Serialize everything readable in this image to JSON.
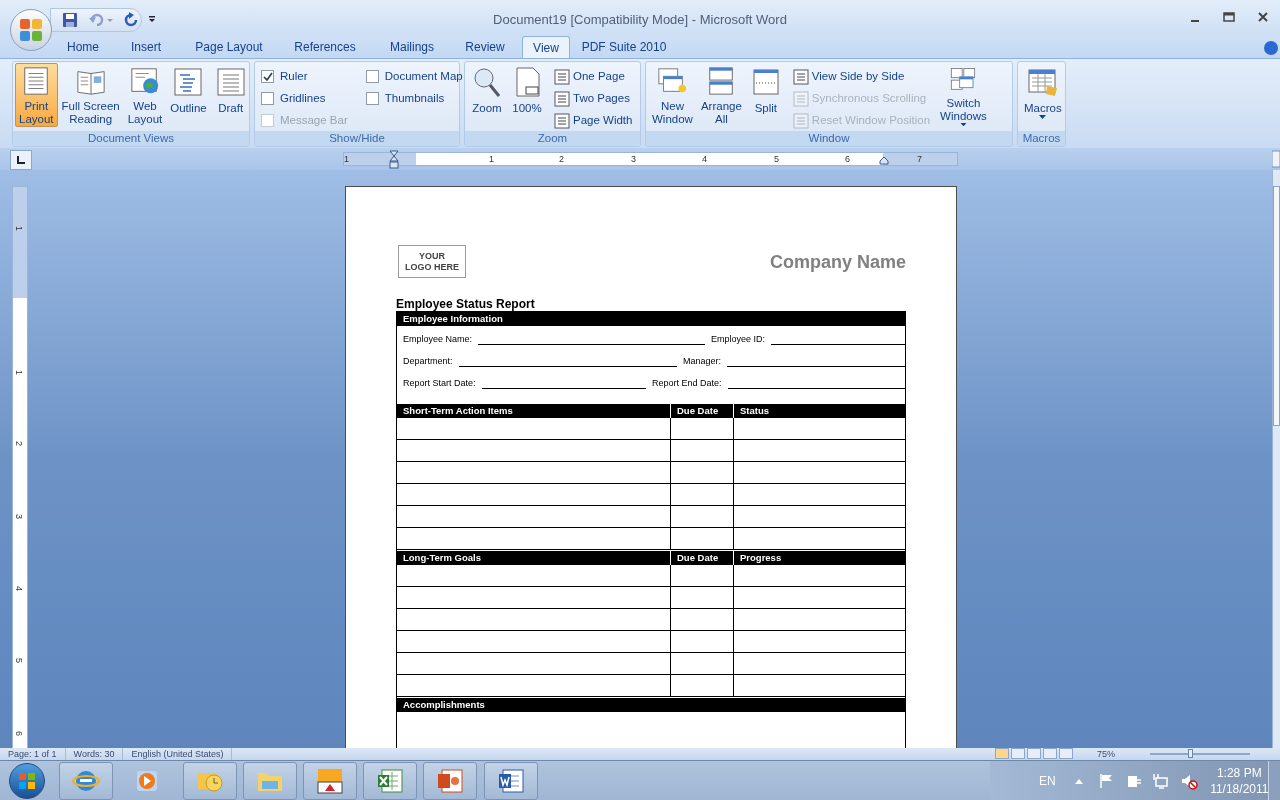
{
  "window": {
    "title": "Document19 [Compatibility Mode] - Microsoft Word"
  },
  "tabs": [
    {
      "label": "Home",
      "selected": false
    },
    {
      "label": "Insert",
      "selected": false
    },
    {
      "label": "Page Layout",
      "selected": false
    },
    {
      "label": "References",
      "selected": false
    },
    {
      "label": "Mailings",
      "selected": false
    },
    {
      "label": "Review",
      "selected": false
    },
    {
      "label": "View",
      "selected": true
    },
    {
      "label": "PDF Suite 2010",
      "selected": false
    }
  ],
  "ribbon": [
    {
      "label": "Document Views",
      "controls": [
        {
          "kind": "large",
          "label": "Print Layout",
          "selected": true
        },
        {
          "kind": "large",
          "label": "Full Screen Reading",
          "selected": false
        },
        {
          "kind": "large",
          "label": "Web Layout",
          "selected": false
        },
        {
          "kind": "large",
          "label": "Outline",
          "selected": false
        },
        {
          "kind": "large",
          "label": "Draft",
          "selected": false
        }
      ]
    },
    {
      "label": "Show/Hide",
      "controls": [
        {
          "kind": "checkbox",
          "label": "Ruler",
          "checked": true,
          "disabled": false
        },
        {
          "kind": "checkbox",
          "label": "Gridlines",
          "checked": false,
          "disabled": false
        },
        {
          "kind": "checkbox",
          "label": "Message Bar",
          "checked": false,
          "disabled": true
        },
        {
          "kind": "checkbox",
          "label": "Document Map",
          "checked": false,
          "disabled": false
        },
        {
          "kind": "checkbox",
          "label": "Thumbnails",
          "checked": false,
          "disabled": false
        }
      ]
    },
    {
      "label": "Zoom",
      "controls": [
        {
          "kind": "large",
          "label": "Zoom",
          "selected": false
        },
        {
          "kind": "large",
          "label": "100%",
          "selected": false
        },
        {
          "kind": "small",
          "label": "One Page",
          "disabled": false
        },
        {
          "kind": "small",
          "label": "Two Pages",
          "disabled": false
        },
        {
          "kind": "small",
          "label": "Page Width",
          "disabled": false
        }
      ]
    },
    {
      "label": "Window",
      "controls": [
        {
          "kind": "large",
          "label": "New Window",
          "selected": false
        },
        {
          "kind": "large",
          "label": "Arrange All",
          "selected": false
        },
        {
          "kind": "large",
          "label": "Split",
          "selected": false
        },
        {
          "kind": "small",
          "label": "View Side by Side",
          "disabled": false
        },
        {
          "kind": "small",
          "label": "Synchronous Scrolling",
          "disabled": true
        },
        {
          "kind": "small",
          "label": "Reset Window Position",
          "disabled": true
        },
        {
          "kind": "large",
          "label": "Switch Windows",
          "selected": false,
          "dropdown": true
        }
      ]
    },
    {
      "label": "Macros",
      "controls": [
        {
          "kind": "large",
          "label": "Macros",
          "selected": false,
          "dropdown": true
        }
      ]
    }
  ],
  "ruler": {
    "labels": [
      "1",
      "1",
      "2",
      "3",
      "4",
      "5",
      "6",
      "7"
    ]
  },
  "vertical_ruler": {
    "labels": [
      "1",
      "1",
      "2",
      "3",
      "4",
      "5",
      "6"
    ]
  },
  "document": {
    "logo": "YOUR LOGO HERE",
    "company": "Company Name",
    "title": "Employee Status Report",
    "info": {
      "header": "Employee Information",
      "rows": [
        [
          "Employee Name:",
          "Employee ID:"
        ],
        [
          "Department:",
          "Manager:"
        ],
        [
          "Report Start Date:",
          "Report End Date:"
        ]
      ]
    },
    "tables": [
      {
        "columns": [
          "Short-Term Action Items",
          "Due Date",
          "Status"
        ]
      },
      {
        "columns": [
          "Long-Term Goals",
          "Due Date",
          "Progress"
        ]
      }
    ],
    "accomplishments": {
      "header": "Accomplishments"
    }
  },
  "status_bar": {
    "items": [
      "Page: 1 of 1",
      "Words: 30",
      "English (United States)"
    ],
    "zoom": "75%",
    "zoom_slider": {
      "level": 0.4
    }
  },
  "tray": {
    "language": "EN",
    "time": "1:28 PM",
    "date": "11/18/2011"
  }
}
